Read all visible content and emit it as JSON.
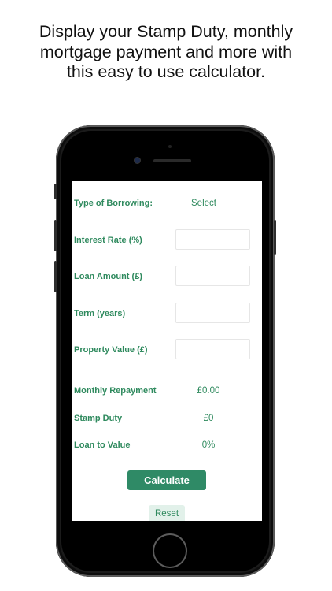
{
  "promo": {
    "line1": "Display your Stamp Duty, monthly",
    "line2": "mortgage payment and more with",
    "line3": "this easy to use calculator."
  },
  "form": {
    "borrowing_type": {
      "label": "Type of Borrowing:",
      "value": "Select"
    },
    "interest_rate": {
      "label": "Interest Rate (%)",
      "value": ""
    },
    "loan_amount": {
      "label": "Loan Amount (£)",
      "value": ""
    },
    "term": {
      "label": "Term (years)",
      "value": ""
    },
    "property_value": {
      "label": "Property Value (£)",
      "value": ""
    }
  },
  "results": {
    "monthly_repayment": {
      "label": "Monthly Repayment",
      "value": "£0.00"
    },
    "stamp_duty": {
      "label": "Stamp Duty",
      "value": "£0"
    },
    "loan_to_value": {
      "label": "Loan to Value",
      "value": "0%"
    }
  },
  "actions": {
    "calculate_label": "Calculate",
    "reset_label": "Reset"
  },
  "colors": {
    "accent": "#2f8a5e",
    "button": "#2f8a66",
    "reset_bg": "#e2f1ea"
  }
}
